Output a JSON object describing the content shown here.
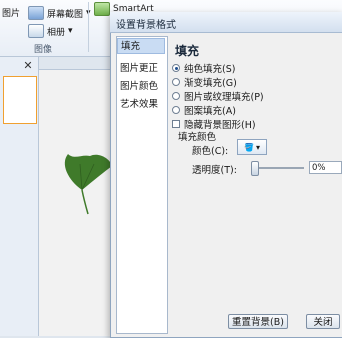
{
  "ribbon": {
    "picture_label": "图片",
    "screenshot_label": "屏幕截图",
    "album_label": "相册",
    "smartart_label": "SmartArt",
    "group_image_label": "图像"
  },
  "left_pane": {
    "close_glyph": "✕"
  },
  "dialog": {
    "title": "设置背景格式",
    "nav_items": [
      "填充",
      "图片更正",
      "图片颜色",
      "艺术效果"
    ],
    "heading": "填充",
    "options": [
      {
        "label": "纯色填充(S)",
        "selected": true
      },
      {
        "label": "渐变填充(G)",
        "selected": false
      },
      {
        "label": "图片或纹理填充(P)",
        "selected": false
      },
      {
        "label": "图案填充(A)",
        "selected": false
      }
    ],
    "hide_bg_label": "隐藏背景图形(H)",
    "fill_color_label": "填充颜色",
    "color_label": "颜色(C):",
    "transparency_label": "透明度(T):",
    "transparency_value": "0%",
    "reset_button": "重置背景(B)",
    "close_button": "关闭"
  },
  "colors": {
    "accent": "#1f4f8f",
    "leaf": "#3f7a2a"
  }
}
